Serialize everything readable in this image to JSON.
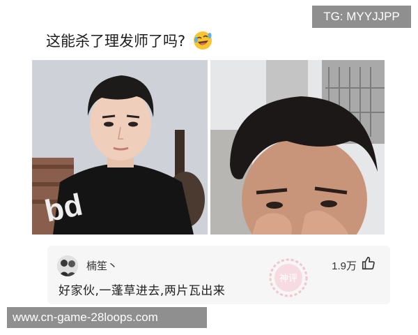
{
  "tg_badge": "TG: MYYJJPP",
  "caption": "这能杀了理发师了吗?",
  "caption_emoji": "rolling-on-floor-laughing-emoji",
  "photos": {
    "left": {
      "icon": "young-man-selfie-photo",
      "shirt_text": "bd"
    },
    "right": {
      "icon": "man-covering-face-selfie-photo"
    }
  },
  "comment": {
    "username": "楠笙丶",
    "likes": "1.9万",
    "text": "好家伙,一蓬草进去,两片瓦出来",
    "avatar_icon": "user-avatar-icon",
    "like_icon": "thumbs-up-icon",
    "stamp_text": "神评",
    "stamp_color": "#f2b8c6"
  },
  "watermark": "www.cn-game-28loops.com",
  "colors": {
    "badge_bg": "#8f8f8f",
    "card_bg": "#f6f6f7"
  }
}
